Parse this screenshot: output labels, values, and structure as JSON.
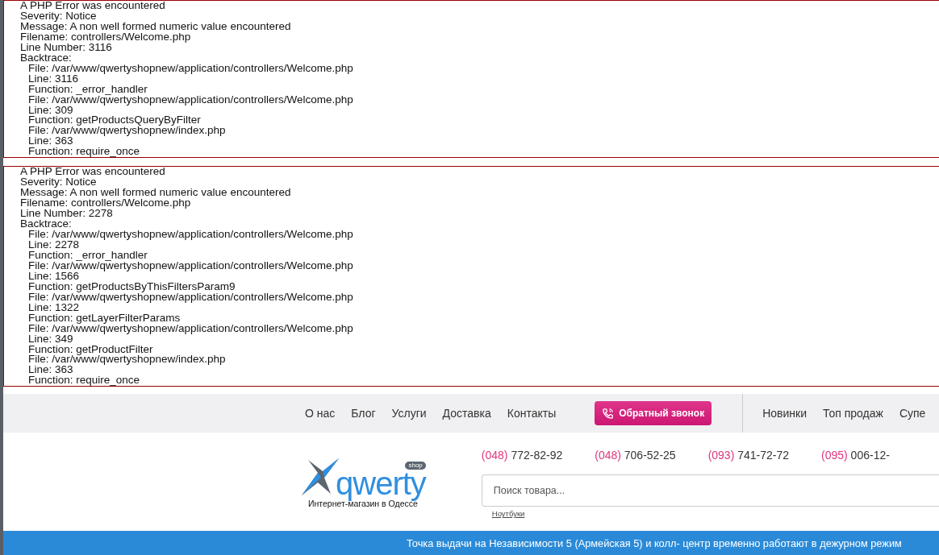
{
  "errors": [
    {
      "heading": "A PHP Error was encountered",
      "severity": "Severity: Notice",
      "message": "Message: A non well formed numeric value encountered",
      "filename": "Filename: controllers/Welcome.php",
      "line_number": "Line Number: 3116",
      "backtrace_label": "Backtrace:",
      "backtrace": [
        {
          "file": "File: /var/www/qwertyshopnew/application/controllers/Welcome.php",
          "line": "Line: 3116",
          "function": "Function: _error_handler"
        },
        {
          "file": "File: /var/www/qwertyshopnew/application/controllers/Welcome.php",
          "line": "Line: 309",
          "function": "Function: getProductsQueryByFilter"
        },
        {
          "file": "File: /var/www/qwertyshopnew/index.php",
          "line": "Line: 363",
          "function": "Function: require_once"
        }
      ]
    },
    {
      "heading": "A PHP Error was encountered",
      "severity": "Severity: Notice",
      "message": "Message: A non well formed numeric value encountered",
      "filename": "Filename: controllers/Welcome.php",
      "line_number": "Line Number: 2278",
      "backtrace_label": "Backtrace:",
      "backtrace": [
        {
          "file": "File: /var/www/qwertyshopnew/application/controllers/Welcome.php",
          "line": "Line: 2278",
          "function": "Function: _error_handler"
        },
        {
          "file": "File: /var/www/qwertyshopnew/application/controllers/Welcome.php",
          "line": "Line: 1566",
          "function": "Function: getProductsByThisFiltersParam9"
        },
        {
          "file": "File: /var/www/qwertyshopnew/application/controllers/Welcome.php",
          "line": "Line: 1322",
          "function": "Function: getLayerFilterParams"
        },
        {
          "file": "File: /var/www/qwertyshopnew/application/controllers/Welcome.php",
          "line": "Line: 349",
          "function": "Function: getProductFilter"
        },
        {
          "file": "File: /var/www/qwertyshopnew/index.php",
          "line": "Line: 363",
          "function": "Function: require_once"
        }
      ]
    }
  ],
  "nav": {
    "links": [
      "О нас",
      "Блог",
      "Услуги",
      "Доставка",
      "Контакты"
    ],
    "callback_button": "Обратный звонок",
    "catalog_links": [
      "Новинки",
      "Топ продаж",
      "Супе"
    ]
  },
  "header": {
    "logo": {
      "name": "qwerty",
      "badge": "shop",
      "tagline": "Интернет-магазин в Одессе"
    },
    "phones": [
      {
        "code": "(048)",
        "number": "772-82-92"
      },
      {
        "code": "(048)",
        "number": "706-52-25"
      },
      {
        "code": "(093)",
        "number": "741-72-72"
      },
      {
        "code": "(095)",
        "number": "006-12-"
      }
    ],
    "search": {
      "placeholder": "Поиск товара..."
    },
    "search_tags": [
      "Ноутбуки"
    ]
  },
  "banner": "Точка выдачи на Независимости 5 (Армейская 5) и колл- центр временно работают в дежурном режим"
}
